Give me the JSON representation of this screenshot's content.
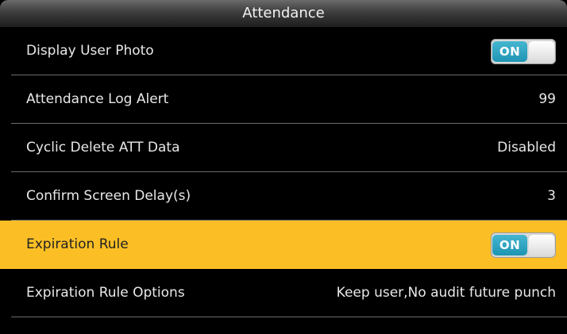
{
  "header": {
    "title": "Attendance"
  },
  "settings": [
    {
      "label": "Display User Photo",
      "type": "toggle",
      "value": "ON",
      "selected": false
    },
    {
      "label": "Attendance Log Alert",
      "type": "text",
      "value": "99",
      "selected": false
    },
    {
      "label": "Cyclic Delete ATT Data",
      "type": "text",
      "value": "Disabled",
      "selected": false
    },
    {
      "label": "Confirm Screen Delay(s)",
      "type": "text",
      "value": "3",
      "selected": false
    },
    {
      "label": "Expiration Rule",
      "type": "toggle",
      "value": "ON",
      "selected": true
    },
    {
      "label": "Expiration Rule Options",
      "type": "text",
      "value": "Keep user,No audit future punch",
      "selected": false
    }
  ],
  "colors": {
    "background": "#000000",
    "selected_row": "#fbbf25",
    "toggle_on": "#1e95b3",
    "text": "#e8e8e8"
  }
}
